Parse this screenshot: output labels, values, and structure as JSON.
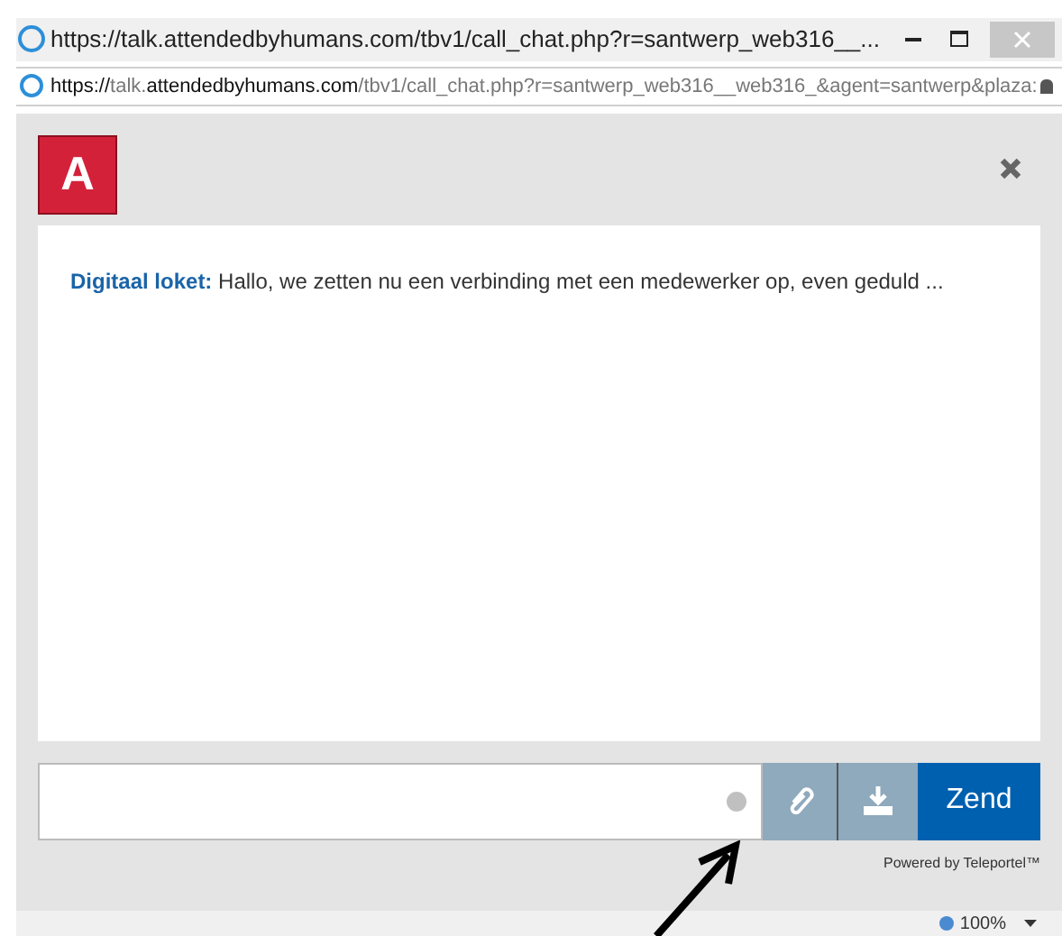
{
  "window": {
    "title": "https://talk.attendedbyhumans.com/tbv1/call_chat.php?r=santwerp_web316__..."
  },
  "address_bar": {
    "scheme": "https://",
    "host_prefix": "talk.",
    "host": "attendedbyhumans.com",
    "path": "/tbv1/call_chat.php?r=santwerp_web316__web316_&agent=santwerp&plaza:"
  },
  "header": {
    "logo": "A"
  },
  "messages": [
    {
      "sender": "Digitaal loket:",
      "text": "Hallo, we zetten nu een verbinding met een medewerker op, even geduld ..."
    }
  ],
  "composer": {
    "status_on": false,
    "send_label": "Zend"
  },
  "footer": "Powered by Teleportel™",
  "status_bar": {
    "zoom": "100%"
  }
}
